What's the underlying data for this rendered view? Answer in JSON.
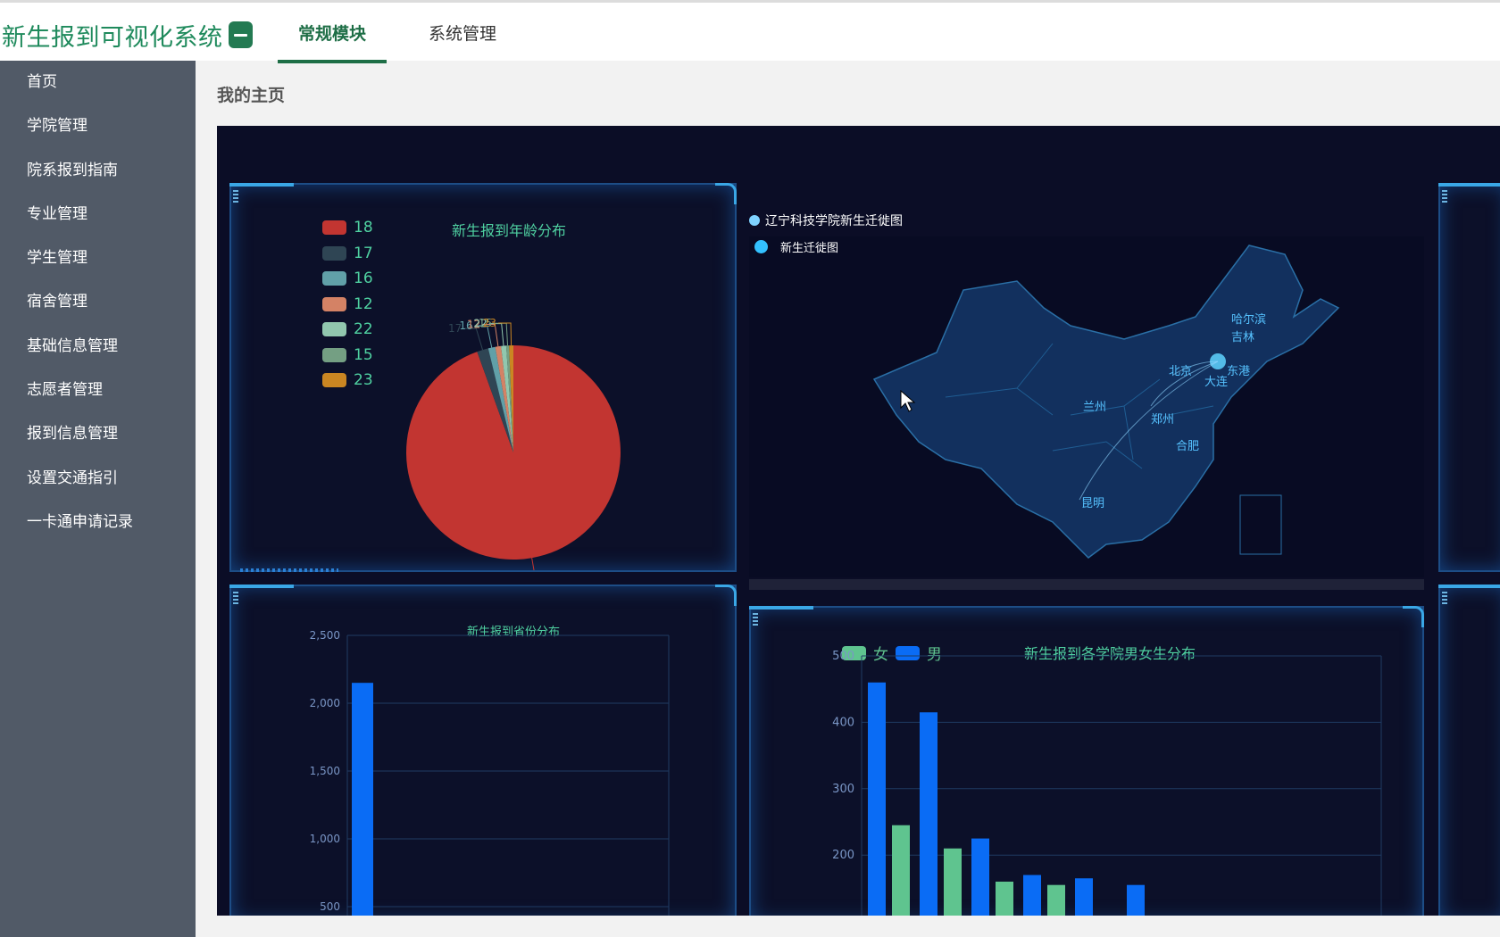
{
  "app": {
    "title": "新生报到可视化系统",
    "menu_icon": "hamburger-menu-icon"
  },
  "topnav": [
    {
      "label": "常规模块",
      "active": true
    },
    {
      "label": "系统管理",
      "active": false
    }
  ],
  "sidebar": {
    "items": [
      {
        "label": "首页"
      },
      {
        "label": "学院管理"
      },
      {
        "label": "院系报到指南"
      },
      {
        "label": "专业管理"
      },
      {
        "label": "学生管理"
      },
      {
        "label": "宿舍管理"
      },
      {
        "label": "基础信息管理"
      },
      {
        "label": "志愿者管理"
      },
      {
        "label": "报到信息管理"
      },
      {
        "label": "设置交通指引"
      },
      {
        "label": "一卡通申请记录"
      }
    ]
  },
  "page": {
    "title": "我的主页"
  },
  "colors": {
    "accent": "#1e6e46",
    "dashboard_bg": "#0b0d26",
    "bar_male": "#0a6cf5",
    "bar_female": "#5fc48f"
  },
  "map": {
    "title": "辽宁科技学院新生迁徙图",
    "legend": "新生迁徙图",
    "cities": [
      "哈尔滨",
      "吉林",
      "北京",
      "东港",
      "大连",
      "兰州",
      "郑州",
      "合肥",
      "昆明"
    ]
  },
  "chart_data": [
    {
      "type": "pie",
      "title": "新生报到年龄分布",
      "legend": [
        "18",
        "17",
        "16",
        "12",
        "22",
        "15",
        "23"
      ],
      "slices": [
        {
          "label": "18",
          "value": 2200,
          "color": "#c23531"
        },
        {
          "label": "17",
          "value": 40,
          "color": "#2f4554"
        },
        {
          "label": "16",
          "value": 25,
          "color": "#61a0a8"
        },
        {
          "label": "12",
          "value": 20,
          "color": "#d48265"
        },
        {
          "label": "22",
          "value": 18,
          "color": "#91c7ae"
        },
        {
          "label": "15",
          "value": 10,
          "color": "#749f83"
        },
        {
          "label": "23",
          "value": 15,
          "color": "#ca8622"
        }
      ]
    },
    {
      "type": "bar",
      "title": "新生报到省份分布",
      "ylim": [
        500,
        2500
      ],
      "yticks": [
        "2,500",
        "2,000",
        "1,500",
        "1,000",
        "500"
      ],
      "values": [
        2150
      ]
    },
    {
      "type": "bar",
      "title": "新生报到各学院男女生分布",
      "legend": [
        "女",
        "男"
      ],
      "yticks": [
        "500",
        "400",
        "300",
        "200"
      ],
      "ylim": [
        150,
        500
      ],
      "series": [
        {
          "name": "男",
          "values": [
            460,
            415,
            225,
            170,
            165,
            155
          ]
        },
        {
          "name": "女",
          "values": [
            245,
            210,
            160,
            155
          ]
        }
      ]
    }
  ]
}
